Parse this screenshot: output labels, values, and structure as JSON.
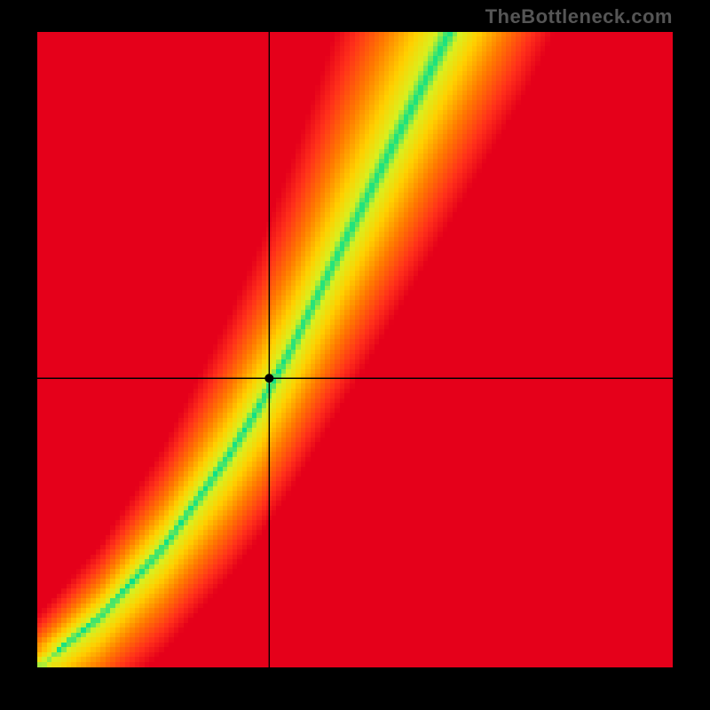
{
  "attribution": "TheBottleneck.com",
  "chart_data": {
    "type": "heatmap",
    "title": "",
    "xlabel": "",
    "ylabel": "",
    "xlim": [
      0,
      1
    ],
    "ylim": [
      0,
      1
    ],
    "grid": "off",
    "legend": "none",
    "colormap": "red-yellow-green (optimal band = green)",
    "crosshair": {
      "x": 0.365,
      "y": 0.455
    },
    "optimal_band": {
      "description": "analytic ridge of green (optimal) region in normalized coords",
      "points_xy": [
        [
          0.0,
          0.0
        ],
        [
          0.1,
          0.08
        ],
        [
          0.2,
          0.19
        ],
        [
          0.3,
          0.33
        ],
        [
          0.35,
          0.41
        ],
        [
          0.4,
          0.5
        ],
        [
          0.45,
          0.6
        ],
        [
          0.5,
          0.7
        ],
        [
          0.55,
          0.8
        ],
        [
          0.6,
          0.9
        ],
        [
          0.65,
          1.0
        ]
      ],
      "half_width_fraction_at_mid": 0.045
    },
    "field_description": "value at (x,y) encodes distance from optimal ridge; near ridge = green, moderate = yellow/orange, far = red; gradient reddest toward far-left and bottom-right corners"
  }
}
